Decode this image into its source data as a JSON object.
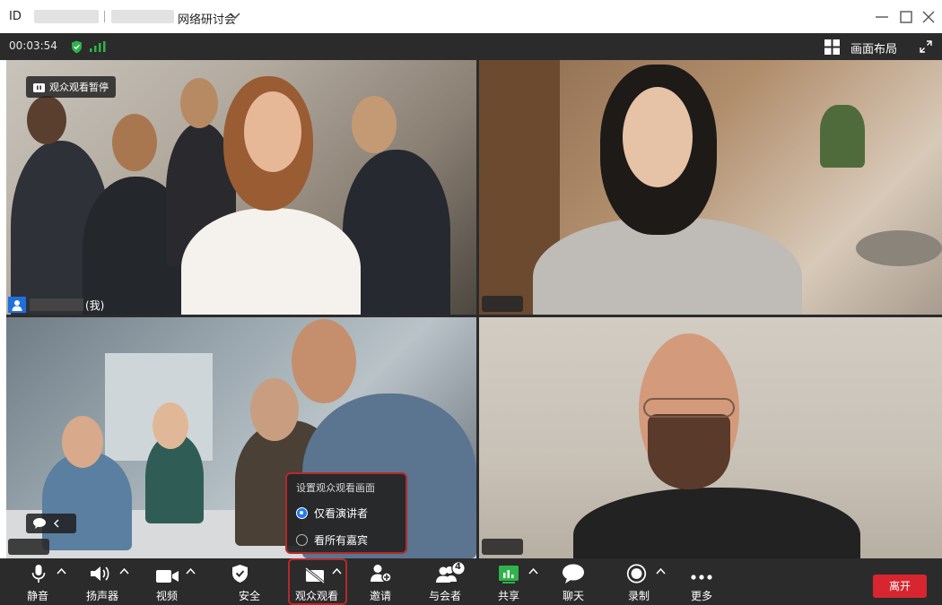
{
  "window": {
    "id_label": "ID",
    "title": "网络研讨会"
  },
  "status": {
    "timer": "00:03:54",
    "layout_label": "画面布局"
  },
  "tiles": {
    "pause_badge": "观众观看暂停",
    "me_suffix": "(我)"
  },
  "popup": {
    "title": "设置观众观看画面",
    "options": [
      {
        "label": "仅看演讲者",
        "selected": true
      },
      {
        "label": "看所有嘉宾",
        "selected": false
      }
    ]
  },
  "toolbar": {
    "mute": "静音",
    "speaker": "扬声器",
    "video": "视频",
    "security": "安全",
    "audience_view": "观众观看",
    "invite": "邀请",
    "participants": "与会者",
    "participants_badge": "4",
    "share": "共享",
    "chat": "聊天",
    "record": "录制",
    "more": "更多",
    "leave": "离开"
  },
  "colors": {
    "accent_blue": "#1e7cf2",
    "leave_red": "#d7262f",
    "share_green": "#2fb34a",
    "highlight_red": "#b52a2a",
    "toolbar_bg": "#2b2b2b"
  }
}
